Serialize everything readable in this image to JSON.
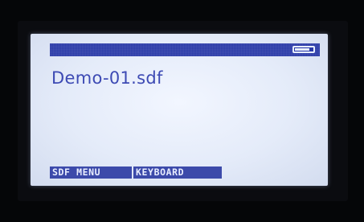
{
  "screen": {
    "file_name": "Demo-01.sdf",
    "battery_level": 0.9,
    "colors": {
      "lcd_background": "#e4ebf9",
      "status_bar": "#2a3aa8",
      "text": "#3d4ab4",
      "softkey_background": "#3c4aaa",
      "softkey_text": "#e9eeff"
    }
  },
  "softkeys": [
    {
      "label": "SDF MENU"
    },
    {
      "label": "KEYBOARD"
    }
  ]
}
